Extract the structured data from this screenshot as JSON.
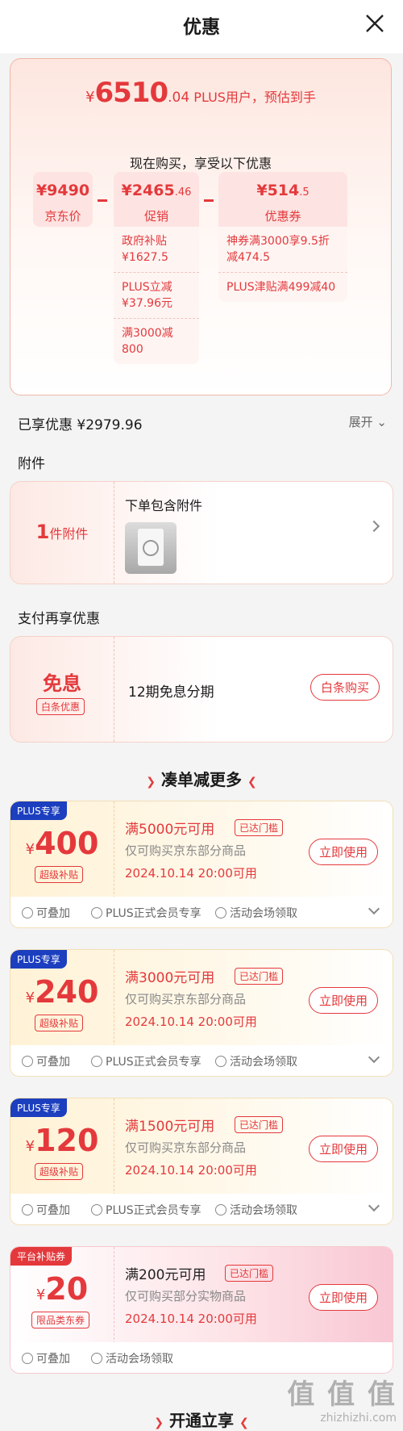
{
  "header": {
    "title": "优惠"
  },
  "summary": {
    "yen": "¥",
    "price_int": "6510",
    "price_dec": ".04",
    "price_label": "PLUS用户，预估到手",
    "subtitle": "现在购买，享受以下优惠"
  },
  "boxes": [
    {
      "value": "¥9490",
      "caption": "京东价"
    },
    {
      "value_int": "¥2465",
      "value_dec": ".46",
      "caption": "促销"
    },
    {
      "value_int": "¥514",
      "value_dec": ".5",
      "caption": "优惠券"
    }
  ],
  "promo_details": [
    "政府补贴 ¥1627.5",
    "PLUS立减 ¥37.96元",
    "满3000减800"
  ],
  "coupon_details": [
    "神券满3000享9.5折减474.5",
    "PLUS津贴满499减40"
  ],
  "saved": {
    "text": "已享优惠 ¥2979.96",
    "expand": "展开"
  },
  "accessory": {
    "section": "附件",
    "count": "1",
    "count_label": "件附件",
    "title": "下单包含附件"
  },
  "pay": {
    "section": "支付再享优惠",
    "badge": "免息",
    "badge_sub": "白条优惠",
    "desc": "12期免息分期",
    "button": "白条购买"
  },
  "more": {
    "title": "凑单减更多"
  },
  "coupons": [
    {
      "tag": "PLUS专享",
      "yen": "¥",
      "amount": "400",
      "kind": "超级补贴",
      "condition": "满5000元可用",
      "reach": "已达门槛",
      "scope": "仅可购买京东部分商品",
      "time": "2024.10.14 20:00可用",
      "use": "立即使用",
      "b1": "可叠加",
      "b2": "PLUS正式会员专享",
      "b3": "活动会场领取"
    },
    {
      "tag": "PLUS专享",
      "yen": "¥",
      "amount": "240",
      "kind": "超级补贴",
      "condition": "满3000元可用",
      "reach": "已达门槛",
      "scope": "仅可购买京东部分商品",
      "time": "2024.10.14 20:00可用",
      "use": "立即使用",
      "b1": "可叠加",
      "b2": "PLUS正式会员专享",
      "b3": "活动会场领取"
    },
    {
      "tag": "PLUS专享",
      "yen": "¥",
      "amount": "120",
      "kind": "超级补贴",
      "condition": "满1500元可用",
      "reach": "已达门槛",
      "scope": "仅可购买京东部分商品",
      "time": "2024.10.14 20:00可用",
      "use": "立即使用",
      "b1": "可叠加",
      "b2": "PLUS正式会员专享",
      "b3": "活动会场领取"
    },
    {
      "tag": "平台补贴券",
      "yen": "¥",
      "amount": "20",
      "kind": "限品类东券",
      "condition": "满200元可用",
      "reach": "已达门槛",
      "scope": "仅可购买部分实物商品",
      "time": "2024.10.14 20:00可用",
      "use": "立即使用",
      "b1": "可叠加",
      "b2": "活动会场领取",
      "b3": ""
    }
  ],
  "footer": {
    "title": "开通立享",
    "watermark": "值 值 值",
    "watermark_url": "zhizhizhi.com"
  }
}
